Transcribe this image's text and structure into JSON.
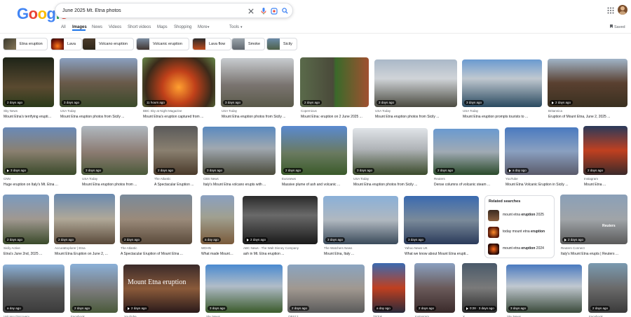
{
  "header": {
    "logo": [
      "G",
      "o",
      "o",
      "g",
      "l",
      "e"
    ],
    "search_value": "June 2025 Mt. Etna photos",
    "colors": {
      "accent": "#1a73e8",
      "text": "#202124",
      "muted": "#5f6368"
    }
  },
  "tabs": [
    "All",
    "Images",
    "News",
    "Videos",
    "Short videos",
    "Maps",
    "Shopping",
    "More",
    "Tools"
  ],
  "saved": "Saved",
  "chips": [
    "Etna eruption",
    "Lava",
    "Volcano eruption",
    "Volcanic eruption",
    "Lava flow",
    "Smoke",
    "Sicily"
  ],
  "results": [
    {
      "age": "2 days ago",
      "source": "Sky News",
      "title": "Mount Etna's terrifying eruption..."
    },
    {
      "age": "3 days ago",
      "source": "USA Today",
      "title": "Mount Etna eruption photos from Sicily ..."
    },
    {
      "age": "11 hours ago",
      "source": "BBC Sky at Night Magazine",
      "title": "Mount Etna's eruption captured from ..."
    },
    {
      "age": "3 days ago",
      "source": "USA Today",
      "title": "Mount Etna eruption photos from Sicily ..."
    },
    {
      "age": "2 days ago",
      "source": "Copernicus",
      "title": "Mount Etna: eruption on 2 June 2025 ..."
    },
    {
      "age": "3 days ago",
      "source": "USA Today",
      "title": "Mount Etna eruption photos from Sicily ..."
    },
    {
      "age": "3 days ago",
      "source": "USA Today",
      "title": "Mount Etna eruption prompts tourists to ..."
    },
    {
      "age": "2 days ago",
      "source": "Britannica",
      "title": "Eruption of Mount Etna, June 2, 2025 ..."
    },
    {
      "age": "3 days ago",
      "source": "CNN",
      "title": "Huge eruption on Italy's Mt. Etna ..."
    },
    {
      "age": "3 days ago",
      "source": "USA Today",
      "title": "Mount Etna eruption photos from ..."
    },
    {
      "age": "2 days ago",
      "source": "The Atlantic",
      "title": "A Spectacular Eruption ..."
    },
    {
      "age": "3 days ago",
      "source": "CBS News",
      "title": "Italy's Mount Etna volcano erupts with ..."
    },
    {
      "age": "2 days ago",
      "source": "Euronews",
      "title": "Massive plume of ash and volcanic ..."
    },
    {
      "age": "3 days ago",
      "source": "USA Today",
      "title": "Mount Etna eruption photos from Sicily ..."
    },
    {
      "age": "2 days ago",
      "source": "Reuters",
      "title": "Dense columns of volcanic steam ..."
    },
    {
      "age": "a day ago",
      "source": "YouTube",
      "title": "Mount Etna Volcanic Eruption in Sicily ..."
    },
    {
      "age": "2 days ago",
      "source": "Instagram",
      "title": "Mount Etna ..."
    },
    {
      "age": "2 days ago",
      "source": "Sicily Active",
      "title": "Etna's June 2nd, 2025 ..."
    },
    {
      "age": "2 days ago",
      "source": "AccuraExplorer | Etna",
      "title": "Mount Etna Eruption on June 2, ..."
    },
    {
      "age": "2 days ago",
      "source": "The Atlantic",
      "title": "A Spectacular Eruption of Mount Etna ..."
    },
    {
      "age": "a day ago",
      "source": "WDHN",
      "title": "What made Mount ..."
    },
    {
      "age": "2 days ago",
      "source": "ABC News - The Walt Disney Company",
      "title": "ash in Mt. Etna eruption ..."
    },
    {
      "age": "3 days ago",
      "source": "The Watchers News",
      "title": "Mount Etna, Italy ..."
    },
    {
      "age": "3 days ago",
      "source": "Yahoo News UK",
      "title": "What we know about Mount Etna erupti..."
    },
    {
      "age": "2 days ago",
      "source": "Reuters Connect",
      "title": "Italy's Mount Etna erupts | Reuters ..."
    },
    {
      "age": "a day ago",
      "source": "Volcano Discovery",
      "title": ""
    },
    {
      "age": "2 days ago",
      "source": "Facebook",
      "title": ""
    },
    {
      "age": "2 days ago",
      "source": "YouTube",
      "title": ""
    },
    {
      "age": "3 days ago",
      "source": "Sky News",
      "title": ""
    },
    {
      "age": "2 days ago",
      "source": "OBS12",
      "title": ""
    },
    {
      "age": "a day ago",
      "source": "TikTok",
      "title": ""
    },
    {
      "age": "2 days ago",
      "source": "Instagram",
      "title": ""
    },
    {
      "age": "0:28 · 3 days ago",
      "source": "X",
      "title": ""
    },
    {
      "age": "3 days ago",
      "source": "Sky News",
      "title": ""
    },
    {
      "age": "2 days ago",
      "source": "Facebook",
      "title": ""
    }
  ],
  "overlay_texts": {
    "reuters": "Reuters",
    "etna_caption": "Mount Etna eruption"
  },
  "related": {
    "heading": "Related searches",
    "items": [
      {
        "prefix": "mount etna ",
        "bold": "eruption",
        "suffix": " 2025"
      },
      {
        "prefix": "today mount etna ",
        "bold": "eruption",
        "suffix": ""
      },
      {
        "prefix": "mount etna ",
        "bold": "eruption",
        "suffix": " 2024"
      }
    ]
  }
}
